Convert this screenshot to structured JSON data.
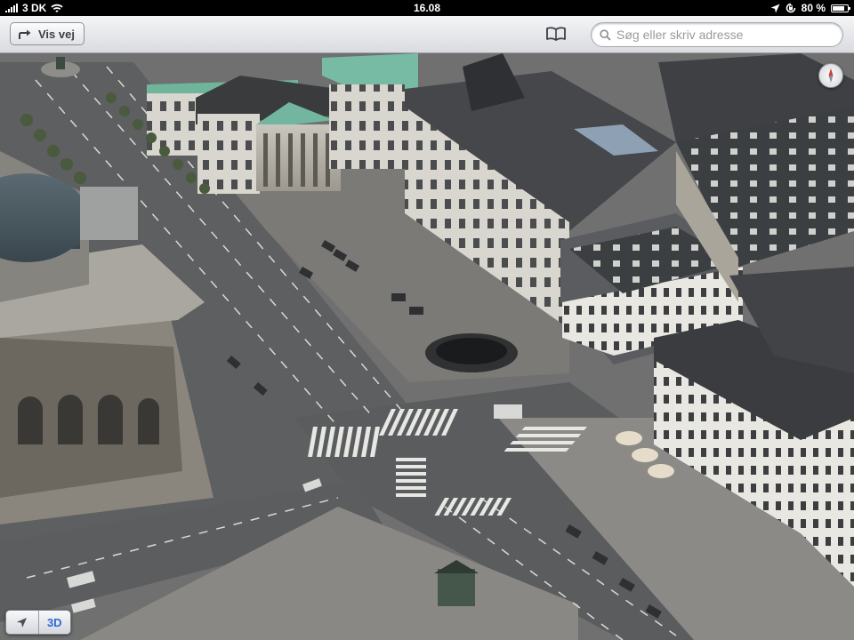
{
  "status_bar": {
    "carrier": "3 DK",
    "time": "16.08",
    "battery_percent": "80 %",
    "battery_level": 0.8,
    "signal_bars": 5,
    "icons": [
      "signal-bars-icon",
      "wifi-icon",
      "location-arrow-icon",
      "rotation-lock-icon",
      "battery-icon"
    ]
  },
  "toolbar": {
    "directions_label": "Vis vej",
    "bookmarks_icon": "book-icon",
    "search_placeholder": "Søg eller skriv adresse"
  },
  "map": {
    "view": "3D flyover",
    "compass_icon": "compass-icon"
  },
  "controls": {
    "location_icon": "location-arrow-icon",
    "three_d_label": "3D"
  },
  "colors": {
    "toolbar_top": "#f4f5f7",
    "toolbar_bottom": "#d9dbdf",
    "accent_blue": "#2f6ad9",
    "roof_green": "#6fb59c",
    "asphalt": "#5f6163"
  }
}
